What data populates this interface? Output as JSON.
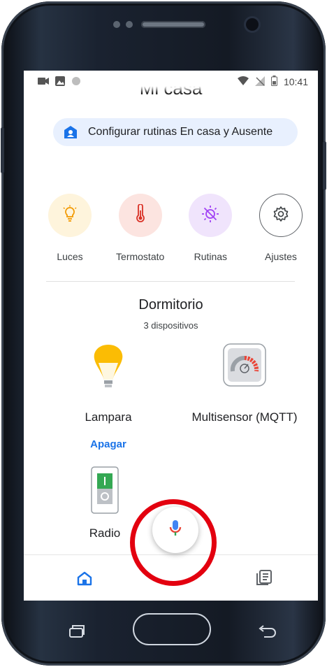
{
  "status_bar": {
    "time": "10:41"
  },
  "header": {
    "title": "Mi casa"
  },
  "routines_chip": {
    "label": "Configurar rutinas En casa y Ausente"
  },
  "shortcuts": [
    {
      "label": "Luces",
      "icon": "lightbulb-icon",
      "bg": "#fef4dc",
      "color": "#f29900"
    },
    {
      "label": "Termostato",
      "icon": "thermometer-icon",
      "bg": "#fce4e0",
      "color": "#d93025"
    },
    {
      "label": "Rutinas",
      "icon": "routine-sun-icon",
      "bg": "#f0e4fc",
      "color": "#a142f4"
    },
    {
      "label": "Ajustes",
      "icon": "gear-icon",
      "bg": "#ffffff",
      "color": "#3c4043"
    }
  ],
  "room": {
    "name": "Dormitorio",
    "device_count": "3 dispositivos",
    "devices": [
      {
        "name": "Lampara",
        "icon": "lamp-bulb-icon",
        "action": "Apagar"
      },
      {
        "name": "Multisensor (MQTT)",
        "icon": "gauge-sensor-icon"
      },
      {
        "name": "Radio",
        "icon": "switch-icon"
      }
    ]
  },
  "colors": {
    "accent": "#1a73e8",
    "highlight_circle": "#e3000f"
  }
}
